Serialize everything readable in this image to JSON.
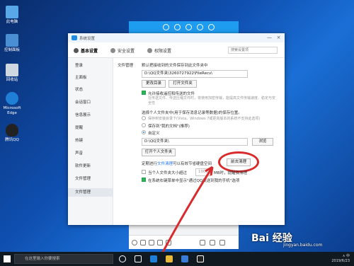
{
  "desktop": {
    "icons": [
      {
        "label": "此电脑",
        "color": "#5aa7e8"
      },
      {
        "label": "控制面板",
        "color": "#4a8fd4"
      },
      {
        "label": "回收站",
        "color": "#cfd8e0"
      },
      {
        "label": "Microsoft Edge",
        "color": "#1f7fd6"
      },
      {
        "label": "腾讯QQ",
        "color": "#222222"
      }
    ]
  },
  "dialog": {
    "title": "系统设置",
    "minimize": "—",
    "close": "×",
    "tabs": [
      {
        "label": "基本设置",
        "active": true
      },
      {
        "label": "安全设置",
        "active": false
      },
      {
        "label": "权限设置",
        "active": false
      }
    ],
    "search_placeholder": "搜索设置项",
    "sidebar": [
      "登录",
      "主面板",
      "状态",
      "会话窗口",
      "信息展示",
      "提醒",
      "热键",
      "声音",
      "软件更新",
      "文件管理"
    ],
    "sidebar_selected": "文件管理",
    "file_mgmt": {
      "label": "文件管理",
      "desc1": "默认把接收到的文件保存到此文件夹中",
      "path1": "D:\\QQ文件夹\\3260727922\\FileRecv\\",
      "btn_change": "更改目录",
      "btn_open": "打开文件夹",
      "allow_label": "允许接收遥控和传送的文件",
      "allow_desc": "在传送文件、传送压缩文件时，将使用加密传输，能提高文件传输速度、稳定与安全性",
      "choose_label": "选择个人文件夹中(用于保存消息记录等数据)的保存位置。",
      "opt1": "保存到安装目录下(Vista、Windows 7或更高版本的系统不支持此选项)",
      "opt2": "保存到\"我的文档\"(推荐)",
      "opt3": "自定义",
      "path2": "D:\\QQ文件夹\\",
      "btn_browse": "浏览",
      "btn_open_personal": "打开个人文件夹",
      "cleanup_prefix": "定期进行",
      "cleanup_link": "文件清理",
      "cleanup_suffix": "可以有效节省硬盘空间",
      "btn_cleanup": "前去清理",
      "limit_prefix": "当个人文件夹大小超过",
      "limit_value": "1000",
      "limit_unit": "MB时，提醒我清理",
      "sync_label": "在系统右键菜单中显示\"通过QQ发送到我的手机\"选项"
    }
  },
  "taskbar": {
    "search_placeholder": "在这里输入你要搜索",
    "time": "2019/6/23",
    "clock_top": "∧ 中"
  },
  "watermark": {
    "brand": "Bai  经验",
    "url": "jingyan.baidu.com"
  }
}
